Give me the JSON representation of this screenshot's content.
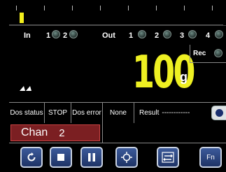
{
  "io": {
    "in_label": "In",
    "in_channels": [
      "1",
      "2"
    ],
    "out_label": "Out",
    "out_channels": [
      "1",
      "2",
      "3",
      "4"
    ]
  },
  "display": {
    "weight_value": "100",
    "unit": "g",
    "rec_label": "Rec"
  },
  "status": {
    "dos_status_label": "Dos status",
    "dos_status_value": "STOP",
    "dos_error_label": "Dos error",
    "dos_error_value": "None",
    "result_label": "Result",
    "result_value": "------------"
  },
  "channel": {
    "label": "Chan",
    "number": "2"
  },
  "buttons": {
    "fn_label": "Fn"
  },
  "colors": {
    "weight": "#eef022",
    "channel_bg": "#7b1f22",
    "button_bg": "#2a4480"
  }
}
